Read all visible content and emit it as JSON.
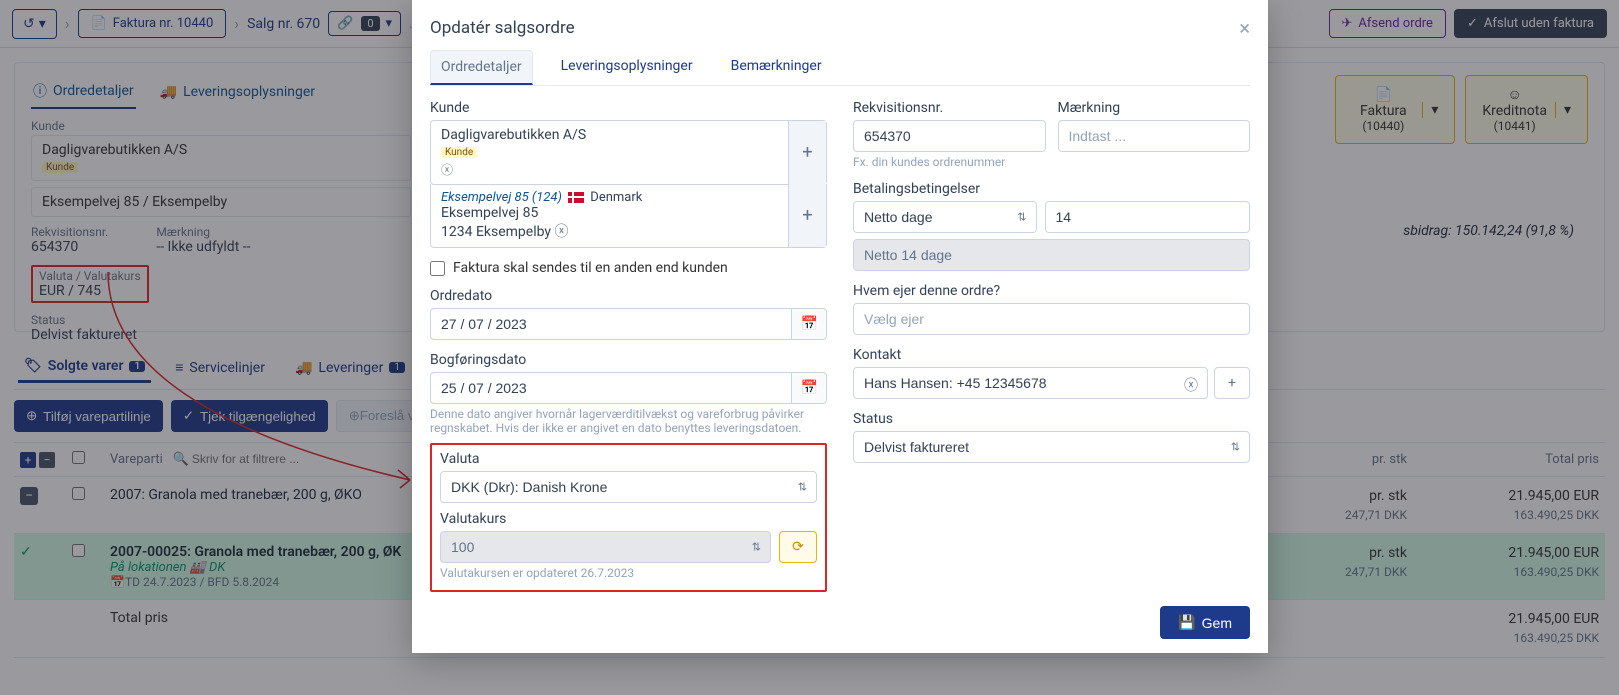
{
  "toolbar": {
    "invoice_crumb": "Faktura nr. 10440",
    "sale_crumb": "Salg nr. 670",
    "link_count": "0",
    "send_order": "Afsend ordre",
    "close_without_invoice": "Afslut uden faktura"
  },
  "panel": {
    "tab_details": "Ordredetaljer",
    "tab_delivery": "Leveringsoplysninger",
    "customer_label": "Kunde",
    "customer_name": "Dagligvarebutikken A/S",
    "customer_badge": "Kunde",
    "customer_addr": "Eksempelvej 85 / Eksempelby",
    "req_label": "Rekvisitionsnr.",
    "req_val": "654370",
    "mark_label": "Mærkning",
    "mark_val": "-- Ikke udfyldt --",
    "vk_label": "Valuta / Valutakurs",
    "vk_val": "EUR / 745",
    "status_label": "Status",
    "status_val": "Delvist faktureret"
  },
  "doc_cards": {
    "invoice": "Faktura",
    "invoice_no": "(10440)",
    "credit": "Kreditnota",
    "credit_no": "(10441)"
  },
  "summary": "sbidrag: 150.142,24 (91,8 %)",
  "items": {
    "tab_sold": "Solgte varer",
    "tab_service": "Servicelinjer",
    "tab_deliv": "Leveringer",
    "count1": "1",
    "count2": "1",
    "btn_add": "Tilføj varepartilinje",
    "btn_check": "Tjek tilgængelighed",
    "btn_suggest": "Foreslå var",
    "hdr_batch": "Vareparti",
    "filter_placeholder": "Skriv for at filtrere ...",
    "hdr_per": "pr. stk",
    "hdr_total": "Total pris"
  },
  "rows": {
    "r1_title": "2007: Granola med tranebær, 200 g, ØKO",
    "r1_per_dkk": "247,71 DKK",
    "r1_eur": "21.945,00 EUR",
    "r1_dkk": "163.490,25 DKK",
    "r2_title": "2007-00025: Granola med tranebær, 200 g, ØK",
    "r2_loc": "På lokationen",
    "r2_loc_code": "DK",
    "r2_meta": "TD 24.7.2023 / BFD 5.8.2024",
    "r2_per_dkk": "247,71 DKK",
    "r2_eur": "21.945,00 EUR",
    "r2_dkk": "163.490,25 DKK",
    "total_label": "Total pris",
    "total_eur": "21.945,00 EUR",
    "total_dkk": "163.490,25 DKK"
  },
  "modal": {
    "title": "Opdatér salgsordre",
    "tab_details": "Ordredetaljer",
    "tab_delivery": "Leveringsoplysninger",
    "tab_notes": "Bemærkninger",
    "customer_label": "Kunde",
    "customer_name": "Dagligvarebutikken A/S",
    "customer_badge": "Kunde",
    "addr_line1": "Eksempelvej 85 (124)",
    "addr_country": "Denmark",
    "addr_line2": "Eksempelvej 85",
    "addr_line3": "1234 Eksempelby",
    "invoice_other": "Faktura skal sendes til en anden end kunden",
    "order_date_label": "Ordredato",
    "order_date": "27 / 07 / 2023",
    "posting_date_label": "Bogføringsdato",
    "posting_date": "25 / 07 / 2023",
    "posting_help": "Denne dato angiver hvornår lagerværditilvækst og vareforbrug påvirker regnskabet. Hvis der ikke er angivet en dato benyttes leveringsdatoen.",
    "valuta_label": "Valuta",
    "valuta_val": "DKK (Dkr): Danish Krone",
    "kurs_label": "Valutakurs",
    "kurs_val": "100",
    "kurs_help": "Valutakursen er opdateret 26.7.2023",
    "req_label": "Rekvisitionsnr.",
    "req_val": "654370",
    "req_help": "Fx. din kundes ordrenummer",
    "mark_label": "Mærkning",
    "mark_placeholder": "Indtast ...",
    "terms_label": "Betalingsbetingelser",
    "terms_sel": "Netto dage",
    "terms_days": "14",
    "terms_display": "Netto 14 dage",
    "owner_label": "Hvem ejer denne ordre?",
    "owner_placeholder": "Vælg ejer",
    "contact_label": "Kontakt",
    "contact_val": "Hans Hansen: +45 12345678",
    "status_label": "Status",
    "status_val": "Delvist faktureret",
    "save": "Gem"
  }
}
